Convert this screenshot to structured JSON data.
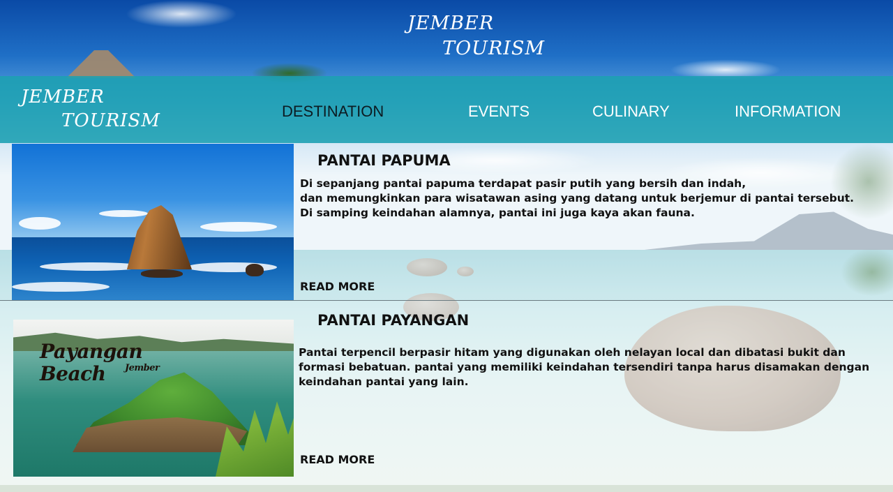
{
  "header": {
    "title_line1": "JEMBER",
    "title_line2": "TOURISM"
  },
  "navbar": {
    "brand_line1": "JEMBER",
    "brand_line2": "TOURISM",
    "items": [
      {
        "label": "DESTINATION",
        "active": true
      },
      {
        "label": "EVENTS",
        "active": false
      },
      {
        "label": "CULINARY",
        "active": false
      },
      {
        "label": "INFORMATION",
        "active": false
      }
    ]
  },
  "destinations": [
    {
      "title": "PANTAI PAPUMA",
      "description": [
        "Di sepanjang pantai papuma terdapat pasir putih yang bersih dan indah,",
        "dan memungkinkan para wisatawan asing yang datang untuk berjemur di pantai tersebut.",
        "Di samping keindahan alamnya, pantai ini juga kaya akan fauna."
      ],
      "read_more": "READ MORE"
    },
    {
      "title": "PANTAI PAYANGAN",
      "description": [
        "Pantai terpencil berpasir hitam yang digunakan oleh nelayan local dan dibatasi bukit dan",
        "formasi bebatuan. pantai yang memiliki keindahan tersendiri tanpa harus disamakan dengan",
        "keindahan pantai yang lain."
      ],
      "read_more": "READ MORE",
      "photo_logo_main": "Payangan Beach",
      "photo_logo_sub": "Jember"
    }
  ],
  "colors": {
    "navbar": "#1ca0b2",
    "active_nav": "#0c1b22",
    "nav_text": "#ffffff",
    "text": "#111111"
  }
}
